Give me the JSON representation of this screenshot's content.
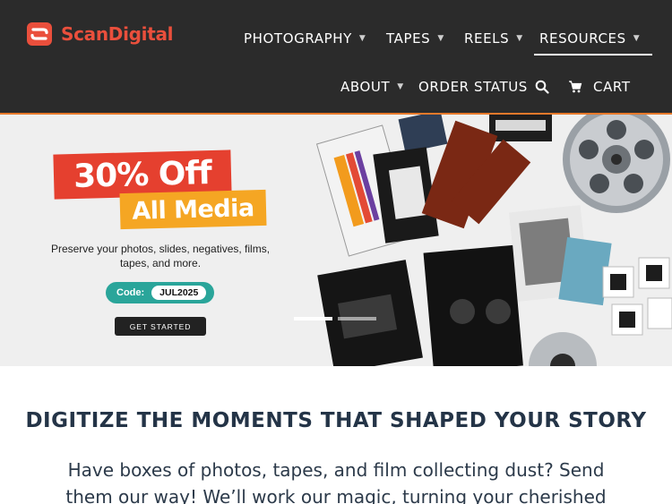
{
  "brand": {
    "name": "ScanDigital",
    "accent": "#ea4f3c"
  },
  "nav": {
    "photography": "PHOTOGRAPHY",
    "tapes": "TAPES",
    "reels": "REELS",
    "resources": "RESOURCES",
    "about": "ABOUT",
    "order_status": "ORDER STATUS",
    "cart": "CART",
    "caret": "▼"
  },
  "icons": {
    "search": "search-icon",
    "cart": "cart-icon",
    "dropdown": "chevron-down-icon"
  },
  "hero": {
    "promo_line_1": "30% Off",
    "promo_line_2": "All Media",
    "subtitle": "Preserve your photos, slides, negatives, films, tapes, and more.",
    "code_label": "Code:",
    "code_value": "JUL2025",
    "cta_label": "GET STARTED",
    "colors": {
      "red": "#e5402f",
      "orange": "#f5a623",
      "teal": "#2aa59a"
    },
    "slides": 2,
    "active_slide": 1
  },
  "content": {
    "headline": "DIGITIZE THE MOMENTS THAT SHAPED YOUR STORY",
    "body": "Have boxes of photos, tapes, and film collecting dust? Send them our way! We’ll work our magic, turning your cherished"
  }
}
